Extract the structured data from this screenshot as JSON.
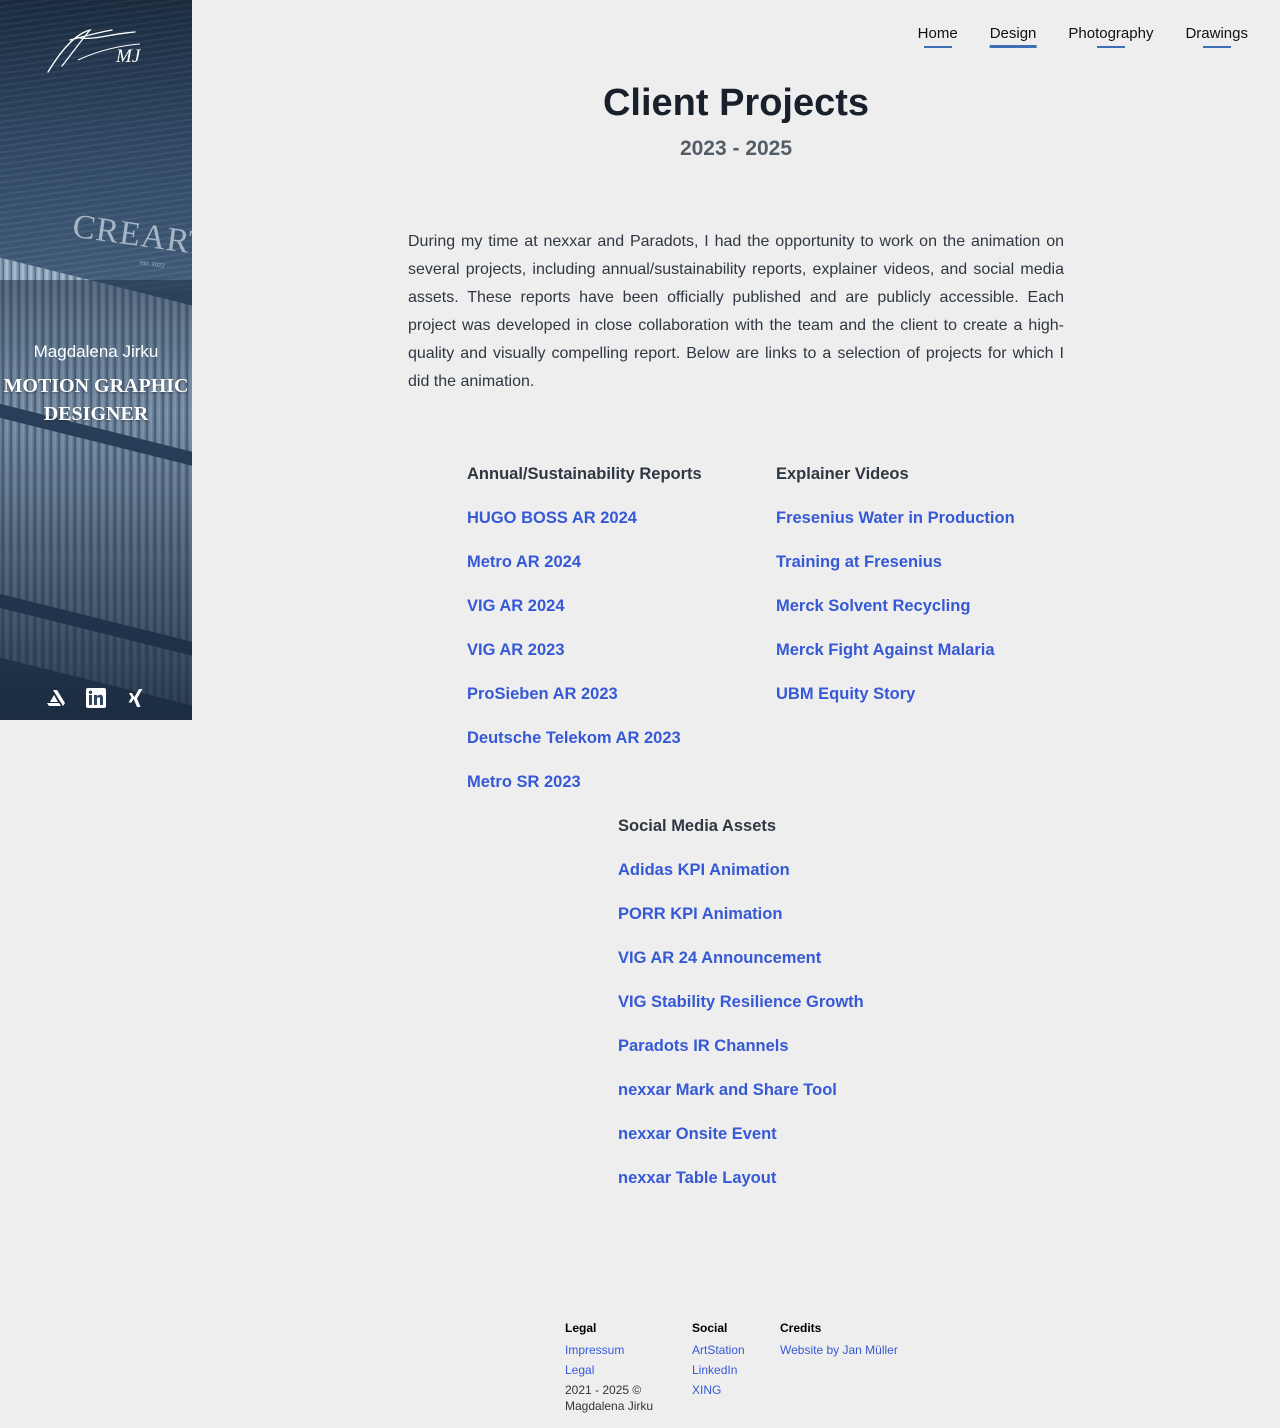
{
  "sidebar": {
    "brand_text": "CREARTI",
    "brand_sub": "est. 2022",
    "name": "Magdalena Jirku",
    "role": "MOTION GRAPHIC DESIGNER",
    "social_icons": [
      "artstation-icon",
      "linkedin-icon",
      "xing-icon"
    ]
  },
  "nav": {
    "items": [
      "Home",
      "Design",
      "Photography",
      "Drawings"
    ],
    "active": "Design",
    "accent": "#3d6fb6"
  },
  "header": {
    "title": "Client Projects",
    "subtitle": "2023 - 2025"
  },
  "intro": "During my time at nexxar and Paradots, I had the opportunity to work on the animation on several projects, including annual/sustainability reports, explainer videos, and social media assets. These reports have been officially published and are publicly accessible. Each project was developed in close collaboration with the team and the client to create a high-quality and visually compelling report. Below are links to a selection of projects for which I did the animation.",
  "sections": {
    "reports": {
      "heading": "Annual/Sustainability Reports",
      "links": [
        "HUGO BOSS AR 2024",
        "Metro AR 2024",
        "VIG AR 2024",
        "VIG AR 2023",
        "ProSieben AR 2023",
        "Deutsche Telekom AR 2023",
        "Metro SR 2023"
      ]
    },
    "videos": {
      "heading": "Explainer Videos",
      "links": [
        "Fresenius Water in Production",
        "Training at Fresenius",
        "Merck Solvent Recycling",
        "Merck Fight Against Malaria",
        "UBM Equity Story"
      ]
    },
    "social": {
      "heading": "Social Media Assets",
      "links": [
        "Adidas KPI Animation",
        "PORR KPI Animation",
        "VIG AR 24 Announcement",
        "VIG Stability Resilience Growth",
        "Paradots IR Channels",
        "nexxar Mark and Share Tool",
        "nexxar Onsite Event",
        "nexxar Table Layout"
      ]
    }
  },
  "footer": {
    "legal": {
      "heading": "Legal",
      "links": [
        "Impressum",
        "Legal"
      ],
      "copyright": "2021 - 2025 © Magdalena Jirku"
    },
    "social": {
      "heading": "Social",
      "links": [
        "ArtStation",
        "LinkedIn",
        "XING"
      ]
    },
    "credits": {
      "heading": "Credits",
      "links": [
        "Website by Jan Müller"
      ]
    }
  },
  "colors": {
    "link": "#3659d6",
    "background": "#eeeeee",
    "sidebar": "#2c4563"
  }
}
